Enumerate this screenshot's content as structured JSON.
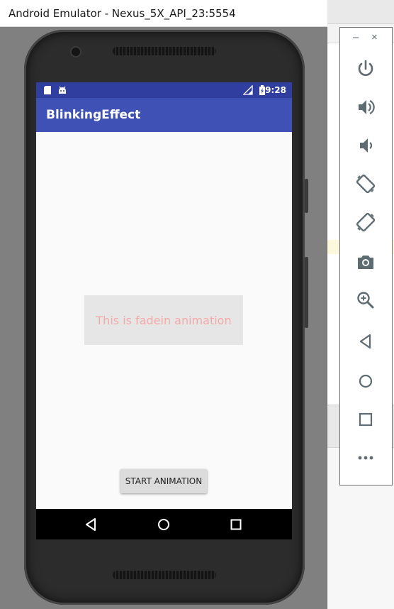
{
  "window": {
    "title": "Android Emulator - Nexus_5X_API_23:5554"
  },
  "statusbar": {
    "time": "9:28"
  },
  "app": {
    "title": "BlinkingEffect",
    "animation_text": "This is fadein animation",
    "start_button_label": "START ANIMATION"
  },
  "toolbar": {
    "minimize_label": "–",
    "close_label": "×",
    "items": [
      {
        "name": "power",
        "icon": "power-icon"
      },
      {
        "name": "volume-up",
        "icon": "volume-up-icon"
      },
      {
        "name": "volume-down",
        "icon": "volume-down-icon"
      },
      {
        "name": "rotate-left",
        "icon": "rotate-left-icon"
      },
      {
        "name": "rotate-right",
        "icon": "rotate-right-icon"
      },
      {
        "name": "screenshot",
        "icon": "camera-icon"
      },
      {
        "name": "zoom",
        "icon": "zoom-in-icon"
      },
      {
        "name": "back",
        "icon": "back-icon"
      },
      {
        "name": "home",
        "icon": "home-icon"
      },
      {
        "name": "overview",
        "icon": "overview-icon"
      },
      {
        "name": "more",
        "icon": "more-icon"
      }
    ],
    "more_label": "•••"
  },
  "colors": {
    "status_bar": "#303f9f",
    "app_bar": "#3f51b5",
    "toolbar_icon": "#5d6b73",
    "animation_text": "#f2a9a9"
  }
}
